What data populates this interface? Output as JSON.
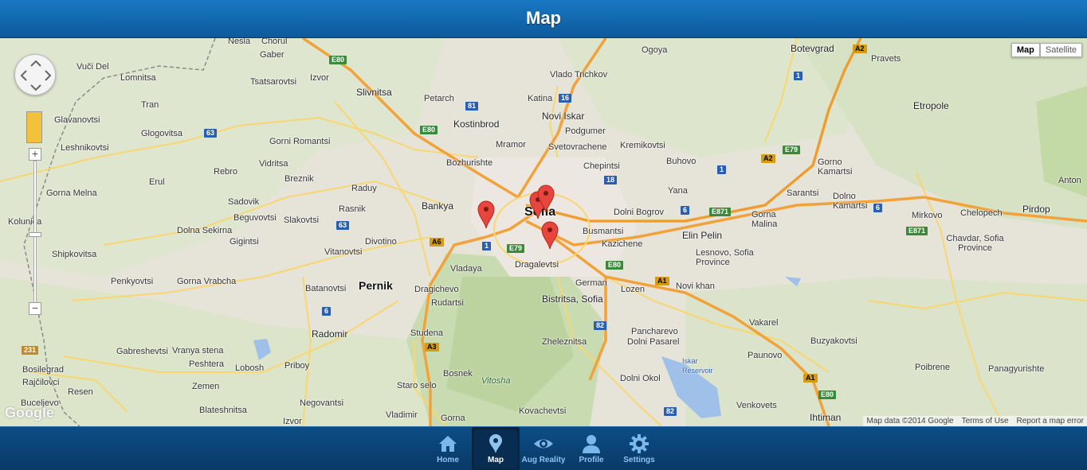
{
  "header": {
    "title": "Map"
  },
  "map": {
    "type_control": {
      "map_label": "Map",
      "satellite_label": "Satellite",
      "selected": "Map"
    },
    "zoom_in_label": "+",
    "zoom_out_label": "−",
    "attribution": {
      "data": "Map data ©2014 Google",
      "terms": "Terms of Use",
      "report": "Report a map error"
    },
    "logo": "Google",
    "markers_count": 4,
    "place_labels": [
      "Nesla",
      "Chorul",
      "Gaber",
      "Vuči Del",
      "Lomnitsa",
      "Tsatsarovtsi",
      "Izvor",
      "Slivnitsa",
      "Petarch",
      "Kostinbrod",
      "Tran",
      "Glavanovtsi",
      "Leshnikovtsi",
      "Glogovitsa",
      "Gorni Romantsi",
      "Vidritsa",
      "Rebro",
      "Breznik",
      "Erul",
      "Gorna Melna",
      "Kolunica",
      "Sadovik",
      "Beguvovtsi",
      "Slakovtsi",
      "Raduy",
      "Rasnik",
      "Bankya",
      "Dolna Sekirna",
      "Gigintsi",
      "Shipkovitsa",
      "Vitanovtsi",
      "Divotino",
      "Penkyovtsi",
      "Gorna Vrabcha",
      "Batanovtsi",
      "Pernik",
      "Dragichevo",
      "Rudartsi",
      "Vladaya",
      "Radomir",
      "Studena",
      "Gabreshevtsi",
      "Vranya stena",
      "Peshtera",
      "Lobosh",
      "Priboy",
      "Bosilegrad",
      "Rajčilovci",
      "Zemen",
      "Resen",
      "Buceljevo",
      "Blateshnitsa",
      "Negovantsi",
      "Izvor",
      "Staro selo",
      "Bosnek",
      "Vladimir",
      "Gorna",
      "Kovachevtsi",
      "Zheleznitsa",
      "Vitosha",
      "Bistritsa, Sofia",
      "Dragalevtsi",
      "Sofia",
      "Mramor",
      "Bozhurishte",
      "Novi Iskar",
      "Katina",
      "Vlado Trichkov",
      "Podgumer",
      "Svetovrachene",
      "Kremikovtsi",
      "Chepintsi",
      "Buhovo",
      "Yana",
      "Ogoya",
      "Busmantsi",
      "Kazichene",
      "Dolni Bogrov",
      "Elin Pelin",
      "Lesnovo, Sofia Province",
      "German",
      "Lozen",
      "Novi khan",
      "Dolni Pasarel",
      "Pancharevo",
      "Dolni Okol",
      "Iskar Reservoir",
      "Vakarel",
      "Paunovo",
      "Buzyakovtsi",
      "Venkovets",
      "Ihtiman",
      "Botevgrad",
      "Pravets",
      "Etropole",
      "Gorno Kamartsi",
      "Dolno Kamartsi",
      "Sarantsi",
      "Gorna Malina",
      "Mirkovo",
      "Chelopech",
      "Chavdar, Sofia Province",
      "Pirdop",
      "Anton",
      "Poibrene",
      "Panagyurishte"
    ]
  },
  "tabs": [
    {
      "label": "Home",
      "icon": "home-icon",
      "active": false
    },
    {
      "label": "Map",
      "icon": "map-pin-icon",
      "active": true
    },
    {
      "label": "Aug Reality",
      "icon": "eye-icon",
      "active": false
    },
    {
      "label": "Profile",
      "icon": "profile-icon",
      "active": false
    },
    {
      "label": "Settings",
      "icon": "gear-icon",
      "active": false
    }
  ],
  "colors": {
    "header": "#1a78c2",
    "tabbar": "#0a3a66",
    "marker": "#e8453c",
    "motorway": "#f2a23a",
    "road": "#f8d670"
  }
}
